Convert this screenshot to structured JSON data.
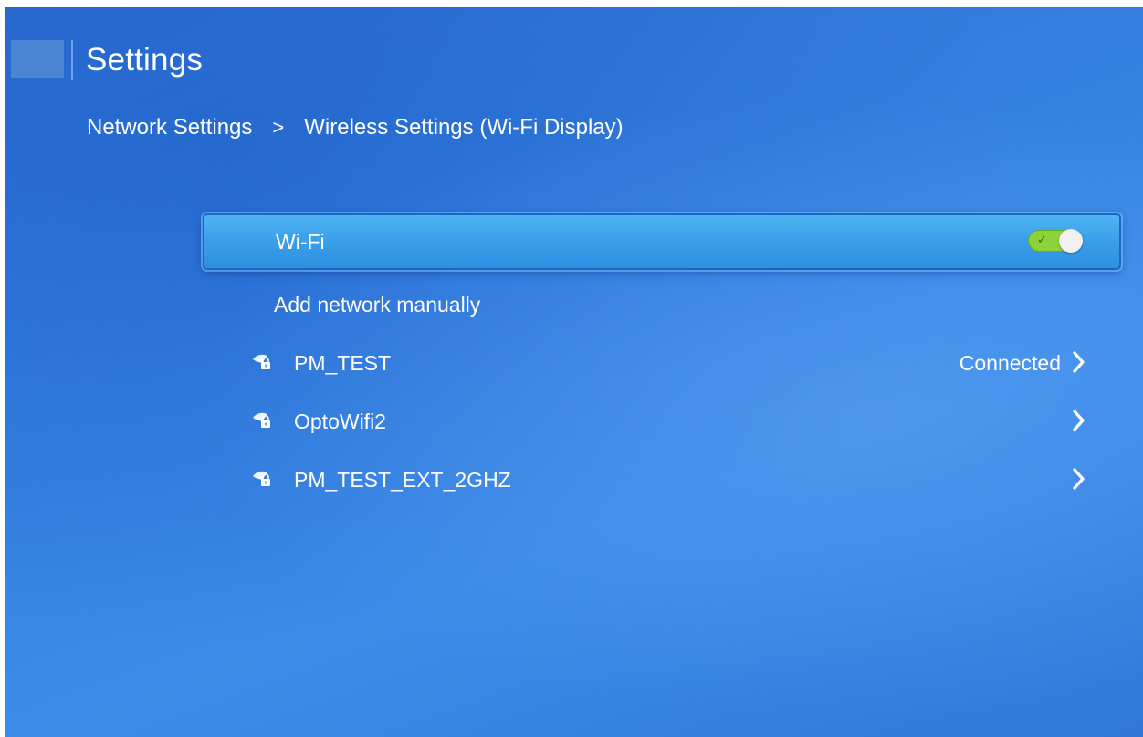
{
  "header": {
    "title": "Settings"
  },
  "breadcrumb": {
    "parent": "Network Settings",
    "separator": ">",
    "current": "Wireless Settings (Wi-Fi Display)"
  },
  "wifi_row": {
    "label": "Wi-Fi",
    "toggle_on": true,
    "toggle_icon": "check-icon",
    "toggle_check_glyph": "✓"
  },
  "add_network": {
    "label": "Add network manually"
  },
  "networks": [
    {
      "name": "PM_TEST",
      "status": "Connected",
      "icon": "wifi-lock-icon"
    },
    {
      "name": "OptoWifi2",
      "status": "",
      "icon": "wifi-lock-icon"
    },
    {
      "name": "PM_TEST_EXT_2GHZ",
      "status": "",
      "icon": "wifi-lock-icon"
    }
  ],
  "colors": {
    "background": "#3480e0",
    "selected_row": "#3aa0ea",
    "toggle_on": "#8ed23a",
    "text": "#ffffff"
  }
}
